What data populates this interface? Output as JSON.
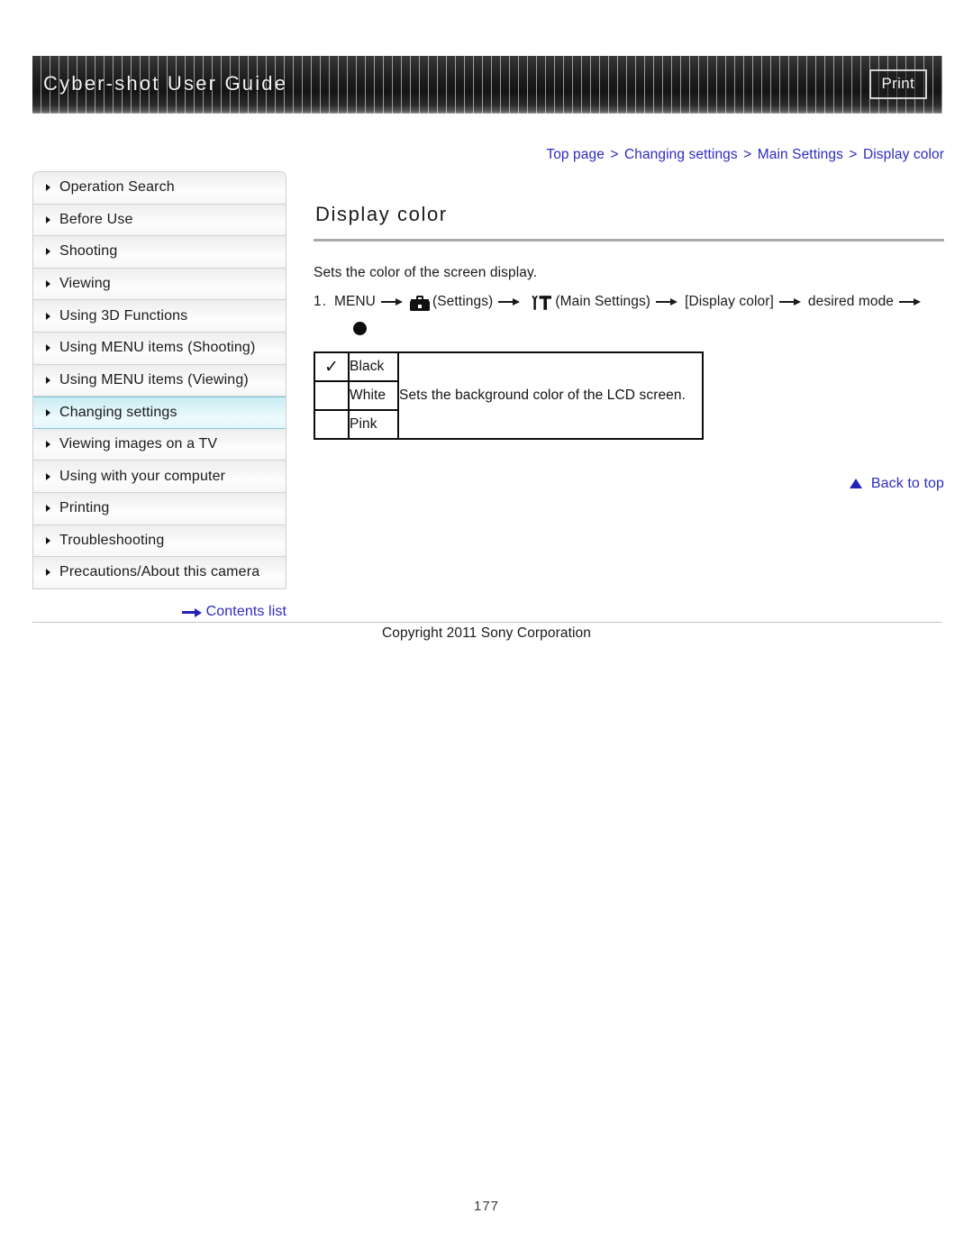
{
  "header": {
    "title": "Cyber-shot User Guide",
    "print_label": "Print"
  },
  "breadcrumb": {
    "separator": ">",
    "items": [
      {
        "label": "Top page"
      },
      {
        "label": "Changing settings"
      },
      {
        "label": "Main Settings"
      },
      {
        "label": "Display color"
      }
    ]
  },
  "sidebar": {
    "items": [
      {
        "label": "Operation Search",
        "active": false
      },
      {
        "label": "Before Use",
        "active": false
      },
      {
        "label": "Shooting",
        "active": false
      },
      {
        "label": "Viewing",
        "active": false
      },
      {
        "label": "Using 3D Functions",
        "active": false
      },
      {
        "label": "Using MENU items (Shooting)",
        "active": false
      },
      {
        "label": "Using MENU items (Viewing)",
        "active": false
      },
      {
        "label": "Changing settings",
        "active": true
      },
      {
        "label": "Viewing images on a TV",
        "active": false
      },
      {
        "label": "Using with your computer",
        "active": false
      },
      {
        "label": "Printing",
        "active": false
      },
      {
        "label": "Troubleshooting",
        "active": false
      },
      {
        "label": "Precautions/About this camera",
        "active": false
      }
    ],
    "contents_link": "Contents list"
  },
  "main": {
    "title": "Display color",
    "intro": "Sets the color of the screen display.",
    "step": {
      "number": "1.",
      "menu_label": "MENU",
      "settings_label": "(Settings)",
      "main_settings_label": "(Main Settings)",
      "item_label": "[Display color]",
      "mode_label": "desired mode",
      "settings_icon": "toolbox-icon",
      "main_settings_icon": "wrench-t-icon",
      "confirm_icon": "filled-circle-icon"
    },
    "table": {
      "check_glyph": "✓",
      "rows": [
        {
          "checked": true,
          "name": "Black"
        },
        {
          "checked": false,
          "name": "White"
        },
        {
          "checked": false,
          "name": "Pink"
        }
      ],
      "description": "Sets the background color of the LCD screen."
    },
    "back_to_top": "Back to top"
  },
  "footer": {
    "copyright": "Copyright 2011 Sony Corporation",
    "page_number": "177"
  },
  "colors": {
    "link": "#2c2cc0",
    "active_nav": "#c9ecf3",
    "rule": "#a9a9a9"
  }
}
